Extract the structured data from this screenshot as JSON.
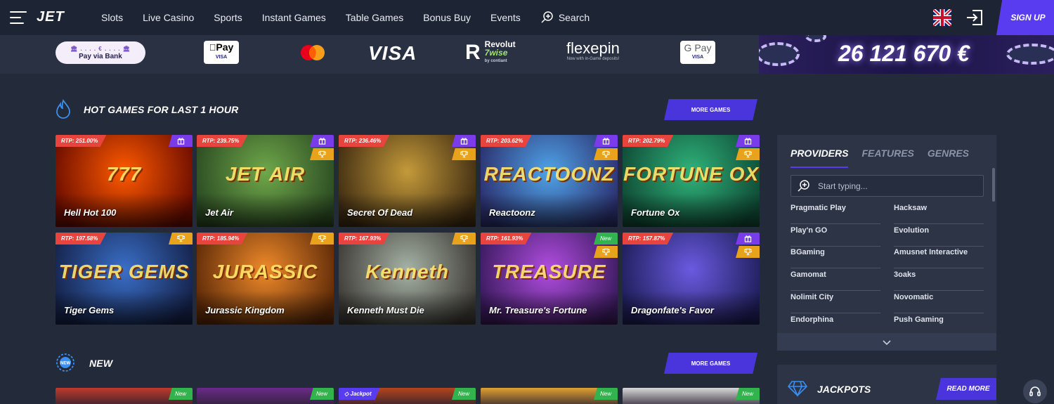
{
  "header": {
    "logo": "JET",
    "nav": [
      {
        "name": "nav-slots",
        "label": "Slots"
      },
      {
        "name": "nav-live-casino",
        "label": "Live Casino"
      },
      {
        "name": "nav-sports",
        "label": "Sports"
      },
      {
        "name": "nav-instant-games",
        "label": "Instant Games"
      },
      {
        "name": "nav-table-games",
        "label": "Table Games"
      },
      {
        "name": "nav-bonus-buy",
        "label": "Bonus Buy"
      },
      {
        "name": "nav-events",
        "label": "Events"
      }
    ],
    "search_label": "Search",
    "signup_label": "SIGN UP",
    "language_icon": "uk-flag-icon",
    "login_icon": "login-icon"
  },
  "payments": {
    "bank_dots": "🏛 . . . . € . . . . 🏛",
    "bank_label": "Pay via Bank",
    "apple": "Pay",
    "apple_sub": "VISA",
    "visa": "VISA",
    "revolut": "Revolut",
    "wise": "7wise",
    "contiant": "by contiant",
    "flexepin": "flexepin",
    "flexepin_sub": "Now with in-Game deposits!",
    "gpay": "G Pay",
    "gpay_sub": "VISA"
  },
  "jackpot_banner": {
    "amount": "26 121 670 €"
  },
  "hot": {
    "title": "HOT GAMES FOR LAST 1 HOUR",
    "more": "MORE GAMES",
    "icon": "flame-icon",
    "games": [
      {
        "name": "Hell Hot 100",
        "rtp": "RTP: 251.00%",
        "badges": [
          "gift"
        ],
        "art": "777",
        "c1": "#ff5a00",
        "c2": "#6b0c00"
      },
      {
        "name": "Jet Air",
        "rtp": "RTP: 239.75%",
        "badges": [
          "gift",
          "trophy"
        ],
        "art": "JET AIR",
        "c1": "#6fa84a",
        "c2": "#2b4a22"
      },
      {
        "name": "Secret Of Dead",
        "rtp": "RTP: 236.46%",
        "badges": [
          "gift",
          "trophy"
        ],
        "art": "",
        "c1": "#c49a3a",
        "c2": "#3f2c12"
      },
      {
        "name": "Reactoonz",
        "rtp": "RTP: 203.62%",
        "badges": [
          "gift",
          "trophy"
        ],
        "art": "REACTOONZ",
        "c1": "#4fa3e8",
        "c2": "#2b2f6e"
      },
      {
        "name": "Fortune Ox",
        "rtp": "RTP: 202.79%",
        "badges": [
          "gift",
          "trophy"
        ],
        "art": "FORTUNE OX",
        "c1": "#2fb37a",
        "c2": "#0f4a35"
      },
      {
        "name": "Tiger Gems",
        "rtp": "RTP: 197.58%",
        "badges": [
          "trophy"
        ],
        "art": "TIGER GEMS",
        "c1": "#3a6fc8",
        "c2": "#15224a"
      },
      {
        "name": "Jurassic Kingdom",
        "rtp": "RTP: 185.94%",
        "badges": [
          "trophy"
        ],
        "art": "JURASSIC",
        "c1": "#ef8a2a",
        "c2": "#5e2a08"
      },
      {
        "name": "Kenneth Must Die",
        "rtp": "RTP: 167.93%",
        "badges": [
          "trophy"
        ],
        "art": "Kenneth",
        "c1": "#a6b3a6",
        "c2": "#3d3a35"
      },
      {
        "name": "Mr. Treasure's Fortune",
        "rtp": "RTP: 161.93%",
        "badges": [
          "new",
          "trophy"
        ],
        "art": "TREASURE",
        "c1": "#b14de0",
        "c2": "#3a1a5e"
      },
      {
        "name": "Dragonfate's Favor",
        "rtp": "RTP: 157.87%",
        "badges": [
          "gift",
          "trophy"
        ],
        "art": "",
        "c1": "#6a5ae0",
        "c2": "#1f1e5a"
      }
    ]
  },
  "new_section": {
    "title": "NEW",
    "more": "MORE GAMES",
    "icon": "new-badge-icon",
    "strips": [
      {
        "badge": "New",
        "c1": "#c0392b"
      },
      {
        "badge": "New",
        "c1": "#6b2a8a"
      },
      {
        "badge": "New",
        "jackpot": "Jackpot",
        "c1": "#b5451b"
      },
      {
        "badge": "New",
        "c1": "#e0a030"
      },
      {
        "badge": "New",
        "c1": "#d8d8d8"
      }
    ]
  },
  "providers_panel": {
    "tabs": [
      "PROVIDERS",
      "FEATURES",
      "GENRES"
    ],
    "search_placeholder": "Start typing...",
    "items": [
      "Pragmatic Play",
      "Hacksaw",
      "Play'n GO",
      "Evolution",
      "BGaming",
      "Amusnet Interactive",
      "Gamomat",
      "3oaks",
      "Nolimit City",
      "Novomatic",
      "Endorphina",
      "Push Gaming"
    ],
    "expand_icon": "chevron-down-icon"
  },
  "jackpots_panel": {
    "title": "JACKPOTS",
    "read_more": "READ MORE",
    "icon": "diamond-icon"
  },
  "colors": {
    "accent": "#5a3cf0",
    "rtp": "#e8443e",
    "gift": "#7a3be8",
    "trophy": "#e8a21c",
    "new": "#33b34d",
    "bg": "#232a39"
  }
}
